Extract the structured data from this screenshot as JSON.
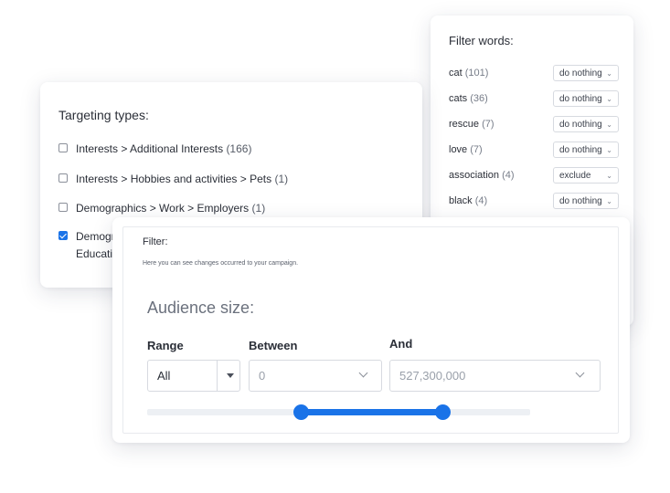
{
  "filter_words": {
    "title": "Filter words:",
    "items": [
      {
        "word": "cat",
        "count": "(101)",
        "action": "do nothing"
      },
      {
        "word": "cats",
        "count": "(36)",
        "action": "do nothing"
      },
      {
        "word": "rescue",
        "count": "(7)",
        "action": "do nothing"
      },
      {
        "word": "love",
        "count": "(7)",
        "action": "do nothing"
      },
      {
        "word": "association",
        "count": "(4)",
        "action": "exclude"
      },
      {
        "word": "black",
        "count": "(4)",
        "action": "do nothing"
      }
    ]
  },
  "targeting": {
    "title": "Targeting types:",
    "items": [
      {
        "label": "Interests > Additional Interests",
        "count": "(166)",
        "checked": false
      },
      {
        "label": "Interests > Hobbies and activities > Pets",
        "count": "(1)",
        "checked": false
      },
      {
        "label": "Demographics > Work > Employers",
        "count": "(1)",
        "checked": false
      },
      {
        "label_line1": "Demogr",
        "label_line2": "Educatio",
        "checked": true
      }
    ]
  },
  "filter_panel": {
    "title": "Filter:",
    "subtitle": "Here you can see changes occurred to your campaign.",
    "audience_title": "Audience size:",
    "range_label": "Range",
    "between_label": "Between",
    "and_label": "And",
    "range_value": "All",
    "between_value": "0",
    "and_value": "527,300,000",
    "slider": {
      "low_fraction": 0.4,
      "high_fraction": 0.77
    }
  },
  "colors": {
    "accent": "#1a73e8"
  }
}
